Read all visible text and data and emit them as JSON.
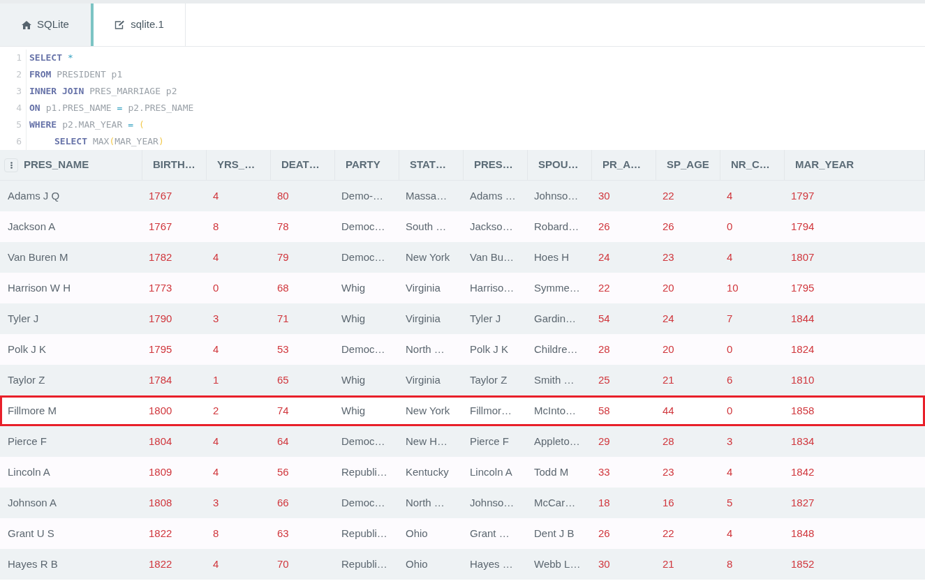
{
  "tabs": [
    {
      "label": "SQLite",
      "selected": false
    },
    {
      "label": "sqlite.1",
      "selected": true
    }
  ],
  "editor": {
    "lines": [
      {
        "number": "1",
        "indent": false,
        "tokens": [
          {
            "kind": "keyword",
            "text": "SELECT"
          },
          {
            "kind": "operator",
            "text": "*"
          }
        ]
      },
      {
        "number": "2",
        "indent": false,
        "tokens": [
          {
            "kind": "keyword",
            "text": "FROM"
          },
          {
            "kind": "name",
            "text": "PRESIDENT p1"
          }
        ]
      },
      {
        "number": "3",
        "indent": false,
        "tokens": [
          {
            "kind": "keyword",
            "text": "INNER JOIN"
          },
          {
            "kind": "name",
            "text": "PRES_MARRIAGE p2"
          }
        ]
      },
      {
        "number": "4",
        "indent": false,
        "tokens": [
          {
            "kind": "keyword",
            "text": "ON"
          },
          {
            "kind": "name",
            "text": "p1.PRES_NAME"
          },
          {
            "kind": "operator",
            "text": "="
          },
          {
            "kind": "name",
            "text": "p2.PRES_NAME"
          }
        ]
      },
      {
        "number": "5",
        "indent": false,
        "tokens": [
          {
            "kind": "keyword",
            "text": "WHERE"
          },
          {
            "kind": "name",
            "text": "p2.MAR_YEAR"
          },
          {
            "kind": "operator",
            "text": "="
          },
          {
            "kind": "open_bracket",
            "text": "("
          }
        ]
      },
      {
        "number": "6",
        "indent": true,
        "tokens": [
          {
            "kind": "keyword",
            "text": "SELECT"
          },
          {
            "kind": "name",
            "text": "MAX"
          },
          {
            "kind": "open_bracket",
            "text": "(",
            "join": true
          },
          {
            "kind": "name",
            "text": "MAR_YEAR"
          },
          {
            "kind": "close_bracket",
            "text": ")"
          }
        ]
      }
    ]
  },
  "table": {
    "columns": [
      {
        "label": "PRES_NAME",
        "kind": "text"
      },
      {
        "label": "BIRTH…",
        "kind": "number"
      },
      {
        "label": "YRS_…",
        "kind": "number"
      },
      {
        "label": "DEAT…",
        "kind": "number"
      },
      {
        "label": "PARTY",
        "kind": "text"
      },
      {
        "label": "STAT…",
        "kind": "text"
      },
      {
        "label": "PRES…",
        "kind": "text"
      },
      {
        "label": "SPOU…",
        "kind": "text"
      },
      {
        "label": "PR_A…",
        "kind": "number"
      },
      {
        "label": "SP_AGE",
        "kind": "number"
      },
      {
        "label": "NR_C…",
        "kind": "number"
      },
      {
        "label": "MAR_YEAR",
        "kind": "number"
      }
    ],
    "rows": [
      {
        "selected": false,
        "cells": [
          "Adams J Q",
          "1767",
          "4",
          "80",
          "Demo-…",
          "Massa…",
          "Adams …",
          "Johnso…",
          "30",
          "22",
          "4",
          "1797"
        ]
      },
      {
        "selected": false,
        "cells": [
          "Jackson A",
          "1767",
          "8",
          "78",
          "Democ…",
          "South …",
          "Jackso…",
          "Robard…",
          "26",
          "26",
          "0",
          "1794"
        ]
      },
      {
        "selected": false,
        "cells": [
          "Van Buren M",
          "1782",
          "4",
          "79",
          "Democ…",
          "New York",
          "Van Bu…",
          "Hoes H",
          "24",
          "23",
          "4",
          "1807"
        ]
      },
      {
        "selected": false,
        "cells": [
          "Harrison W H",
          "1773",
          "0",
          "68",
          "Whig",
          "Virginia",
          "Harriso…",
          "Symme…",
          "22",
          "20",
          "10",
          "1795"
        ]
      },
      {
        "selected": false,
        "cells": [
          "Tyler J",
          "1790",
          "3",
          "71",
          "Whig",
          "Virginia",
          "Tyler J",
          "Gardin…",
          "54",
          "24",
          "7",
          "1844"
        ]
      },
      {
        "selected": false,
        "cells": [
          "Polk J K",
          "1795",
          "4",
          "53",
          "Democ…",
          "North …",
          "Polk J K",
          "Childre…",
          "28",
          "20",
          "0",
          "1824"
        ]
      },
      {
        "selected": false,
        "cells": [
          "Taylor Z",
          "1784",
          "1",
          "65",
          "Whig",
          "Virginia",
          "Taylor Z",
          "Smith …",
          "25",
          "21",
          "6",
          "1810"
        ]
      },
      {
        "selected": true,
        "cells": [
          "Fillmore M",
          "1800",
          "2",
          "74",
          "Whig",
          "New York",
          "Fillmor…",
          "McInto…",
          "58",
          "44",
          "0",
          "1858"
        ]
      },
      {
        "selected": false,
        "cells": [
          "Pierce F",
          "1804",
          "4",
          "64",
          "Democ…",
          "New H…",
          "Pierce F",
          "Appleto…",
          "29",
          "28",
          "3",
          "1834"
        ]
      },
      {
        "selected": false,
        "cells": [
          "Lincoln A",
          "1809",
          "4",
          "56",
          "Republi…",
          "Kentucky",
          "Lincoln A",
          "Todd M",
          "33",
          "23",
          "4",
          "1842"
        ]
      },
      {
        "selected": false,
        "cells": [
          "Johnson A",
          "1808",
          "3",
          "66",
          "Democ…",
          "North …",
          "Johnso…",
          "McCar…",
          "18",
          "16",
          "5",
          "1827"
        ]
      },
      {
        "selected": false,
        "cells": [
          "Grant U S",
          "1822",
          "8",
          "63",
          "Republi…",
          "Ohio",
          "Grant …",
          "Dent J B",
          "26",
          "22",
          "4",
          "1848"
        ]
      },
      {
        "selected": false,
        "cells": [
          "Hayes R B",
          "1822",
          "4",
          "70",
          "Republi…",
          "Ohio",
          "Hayes …",
          "Webb L…",
          "30",
          "21",
          "8",
          "1852"
        ]
      }
    ]
  }
}
